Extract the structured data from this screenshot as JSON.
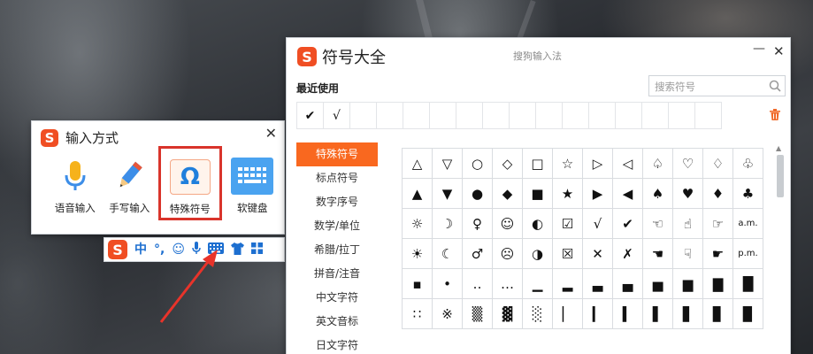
{
  "ime_panel": {
    "logo": "S",
    "title": "输入方式",
    "close": "✕",
    "tools": [
      {
        "label": "语音输入",
        "icon": "microphone-icon"
      },
      {
        "label": "手写输入",
        "icon": "pencil-icon"
      },
      {
        "label": "特殊符号",
        "icon": "omega-icon",
        "glyph": "Ω",
        "selected": true
      },
      {
        "label": "软键盘",
        "icon": "keyboard-icon"
      }
    ]
  },
  "statusbar": {
    "logo": "S",
    "items": [
      "中",
      "°,",
      "☺",
      "🎤",
      "⌨",
      "👕",
      "▦"
    ],
    "icons": [
      "chinese-mode-icon",
      "punctuation-icon",
      "emoji-icon",
      "voice-icon",
      "keyboard-icon",
      "skin-icon",
      "toolbox-icon"
    ]
  },
  "symbol_window": {
    "logo": "S",
    "title": "符号大全",
    "brand": "搜狗输入法",
    "minimize": "—",
    "close": "✕",
    "recent_label": "最近使用",
    "search_placeholder": "搜索符号",
    "recent": [
      "✔",
      "√",
      "",
      "",
      "",
      "",
      "",
      "",
      "",
      "",
      "",
      "",
      "",
      "",
      "",
      ""
    ],
    "categories": [
      "特殊符号",
      "标点符号",
      "数字序号",
      "数学/单位",
      "希腊/拉丁",
      "拼音/注音",
      "中文字符",
      "英文音标",
      "日文字符"
    ],
    "active_category": 0,
    "symbols": [
      [
        "△",
        "▽",
        "○",
        "◇",
        "□",
        "☆",
        "▷",
        "◁",
        "♤",
        "♡",
        "♢",
        "♧"
      ],
      [
        "▲",
        "▼",
        "●",
        "◆",
        "■",
        "★",
        "▶",
        "◀",
        "♠",
        "♥",
        "♦",
        "♣"
      ],
      [
        "☼",
        "☽",
        "♀",
        "☺",
        "◐",
        "☑",
        "√",
        "✔",
        "☜",
        "☝",
        "☞",
        "a.m."
      ],
      [
        "☀",
        "☾",
        "♂",
        "☹",
        "◑",
        "☒",
        "✕",
        "✗",
        "☚",
        "☟",
        "☛",
        "p.m."
      ],
      [
        "▪",
        "•",
        "‥",
        "…",
        "▁",
        "▂",
        "▃",
        "▄",
        "▅",
        "▆",
        "▇",
        "█"
      ],
      [
        "∷",
        "※",
        "▒",
        "▓",
        "░",
        "▏",
        "▎",
        "▍",
        "▌",
        "▋",
        "▊",
        "▉"
      ]
    ]
  },
  "colors": {
    "accent": "#f9681f",
    "logo": "#f04e23",
    "highlight_border": "#d9342b",
    "arrow": "#e8332a",
    "link_blue": "#1d6fd0"
  }
}
